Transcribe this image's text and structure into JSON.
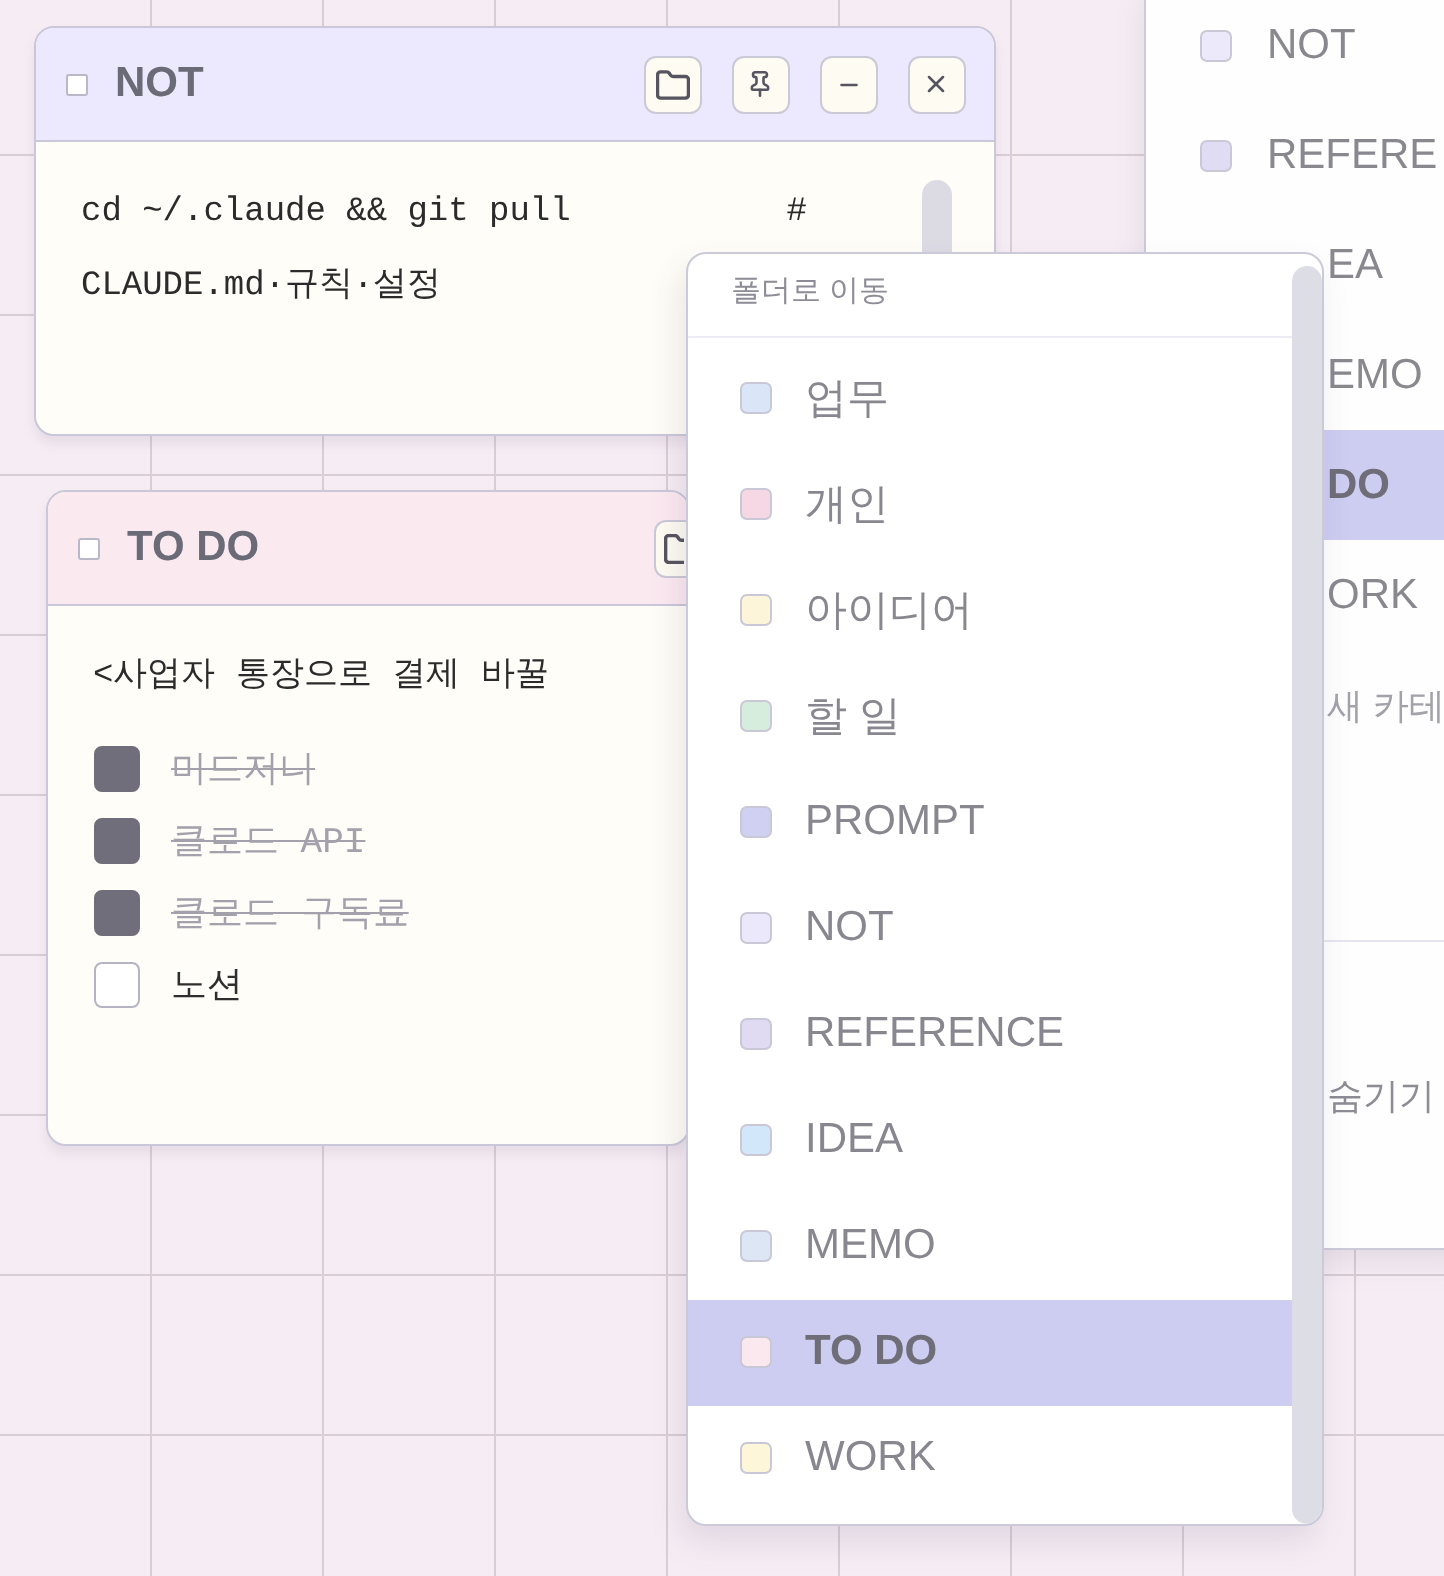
{
  "notes": [
    {
      "title": "NOT",
      "color": "#ece8fd",
      "buttons": [
        {
          "kind": "folder"
        },
        {
          "kind": "pin"
        },
        {
          "kind": "minimize"
        },
        {
          "kind": "close"
        }
      ],
      "lines": [
        {
          "text": "cd ~/.claude && git pull",
          "aside": "#"
        },
        {
          "text": "CLAUDE.md·규칙·설정"
        }
      ]
    },
    {
      "title": "TO DO",
      "color": "#fbe9f0",
      "buttons": [
        {
          "kind": "folder"
        }
      ],
      "lines": [
        {
          "text": "<사업자 통장으로 결제 바꿀"
        }
      ],
      "checklist": [
        {
          "text": "미드저니",
          "checked": true
        },
        {
          "text": "클로드 API",
          "checked": true
        },
        {
          "text": "클로드 구독료",
          "checked": true
        },
        {
          "text": "노션",
          "checked": false
        }
      ]
    }
  ],
  "folder_menu": {
    "title": "폴더로 이동",
    "items": [
      {
        "label": "업무",
        "color": "#dae6f7",
        "selected": false
      },
      {
        "label": "개인",
        "color": "#f6d8e4",
        "selected": false
      },
      {
        "label": "아이디어",
        "color": "#fdf5d9",
        "selected": false
      },
      {
        "label": "할 일",
        "color": "#d6ecdc",
        "selected": false
      },
      {
        "label": "PROMPT",
        "color": "#cfd0f2",
        "selected": false
      },
      {
        "label": "NOT",
        "color": "#ece8fb",
        "selected": false
      },
      {
        "label": "REFERENCE",
        "color": "#e0dbf3",
        "selected": false
      },
      {
        "label": "IDEA",
        "color": "#d3e7fa",
        "selected": false
      },
      {
        "label": "MEMO",
        "color": "#dde6f5",
        "selected": false
      },
      {
        "label": "TO DO",
        "color": "#fbe8ee",
        "selected": true
      },
      {
        "label": "WORK",
        "color": "#fdf6d8",
        "selected": false
      }
    ]
  },
  "category_panel": {
    "items": [
      {
        "label": "NOT",
        "color": "#ece9fb",
        "selected": false
      },
      {
        "label": "REFERE",
        "color": "#e0dcf3",
        "selected": false
      },
      {
        "label": "EA",
        "selected": false
      },
      {
        "label": "EMO",
        "selected": false
      },
      {
        "label": "DO",
        "selected": true
      },
      {
        "label": "ORK",
        "selected": false
      }
    ],
    "new_item": "새 카테",
    "hide_item": "숨기기"
  }
}
